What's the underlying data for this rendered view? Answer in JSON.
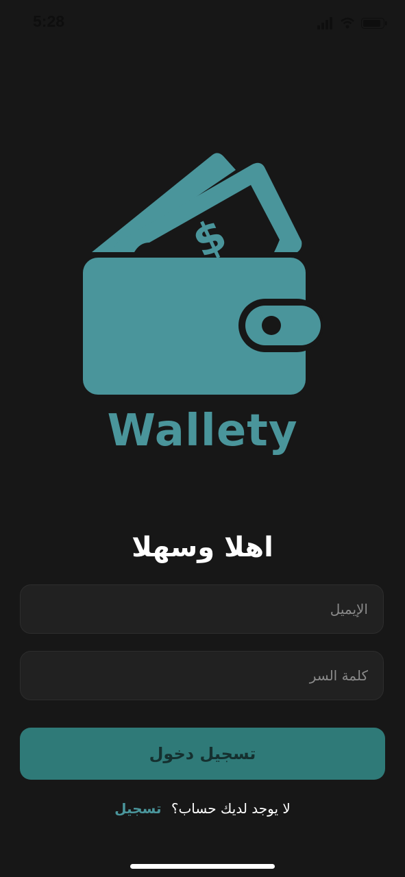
{
  "status_bar": {
    "time": "5:28",
    "icons": [
      "signal-icon",
      "wifi-icon",
      "battery-icon"
    ]
  },
  "brand": {
    "name": "Wallety",
    "logo_icon": "wallet-money-icon",
    "color": "#4a959b"
  },
  "login": {
    "title": "اهلا وسهلا",
    "email_placeholder": "الإيميل",
    "password_placeholder": "كلمة السر",
    "submit_label": "تسجيل دخول",
    "signup_prompt": "لا يوجد لديك حساب؟",
    "signup_link": "تسجيل"
  },
  "colors": {
    "background": "#171717",
    "accent": "#4a959b",
    "button": "#2f7a78",
    "field": "#212121"
  }
}
